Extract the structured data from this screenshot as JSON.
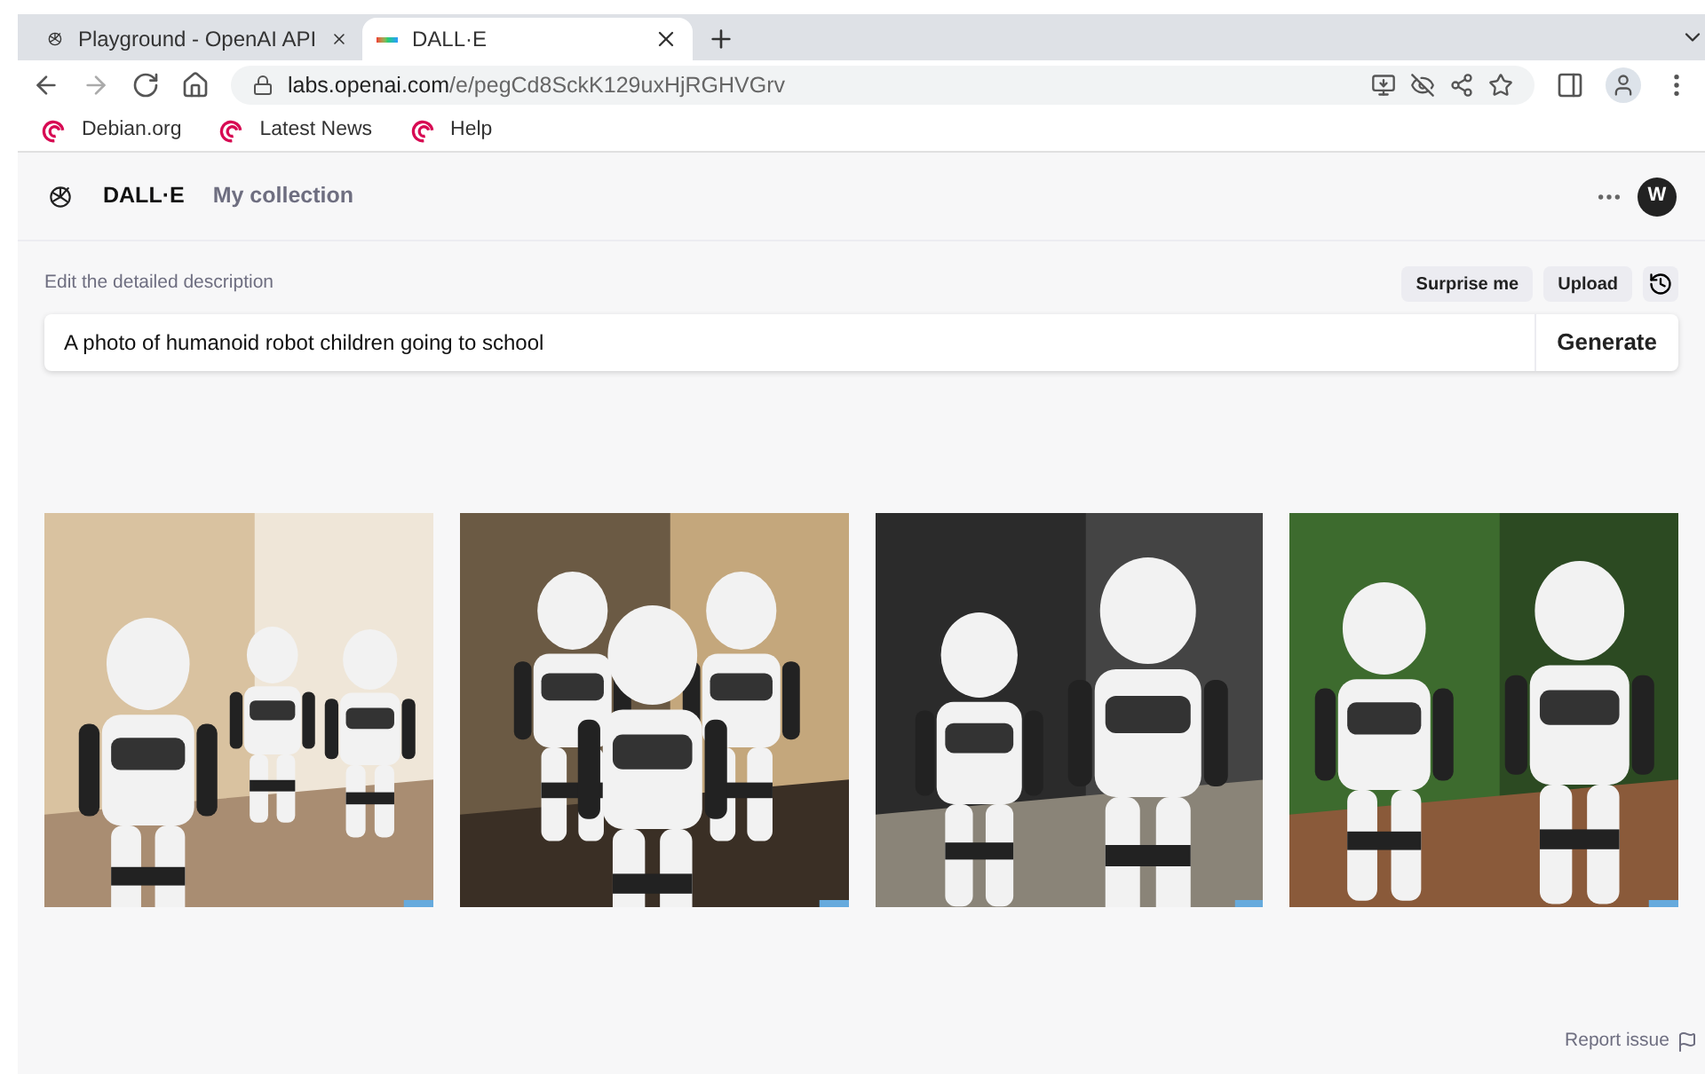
{
  "browser": {
    "tabs": [
      {
        "title": "Playground - OpenAI API",
        "selected": false
      },
      {
        "title": "DALL·E",
        "selected": true
      }
    ],
    "url_host": "labs.openai.com",
    "url_path": "/e/pegCd8SckK129uxHjRGHVGrv",
    "bookmarks": [
      "Debian.org",
      "Latest News",
      "Help"
    ]
  },
  "header": {
    "brand": "DALL·E",
    "nav": "My collection",
    "avatar": "W"
  },
  "prompt": {
    "label": "Edit the detailed description",
    "buttons": [
      "Surprise me",
      "Upload"
    ],
    "value": "A photo of humanoid robot children going to school",
    "submit": "Generate"
  },
  "footer": {
    "link": "Report issue"
  }
}
